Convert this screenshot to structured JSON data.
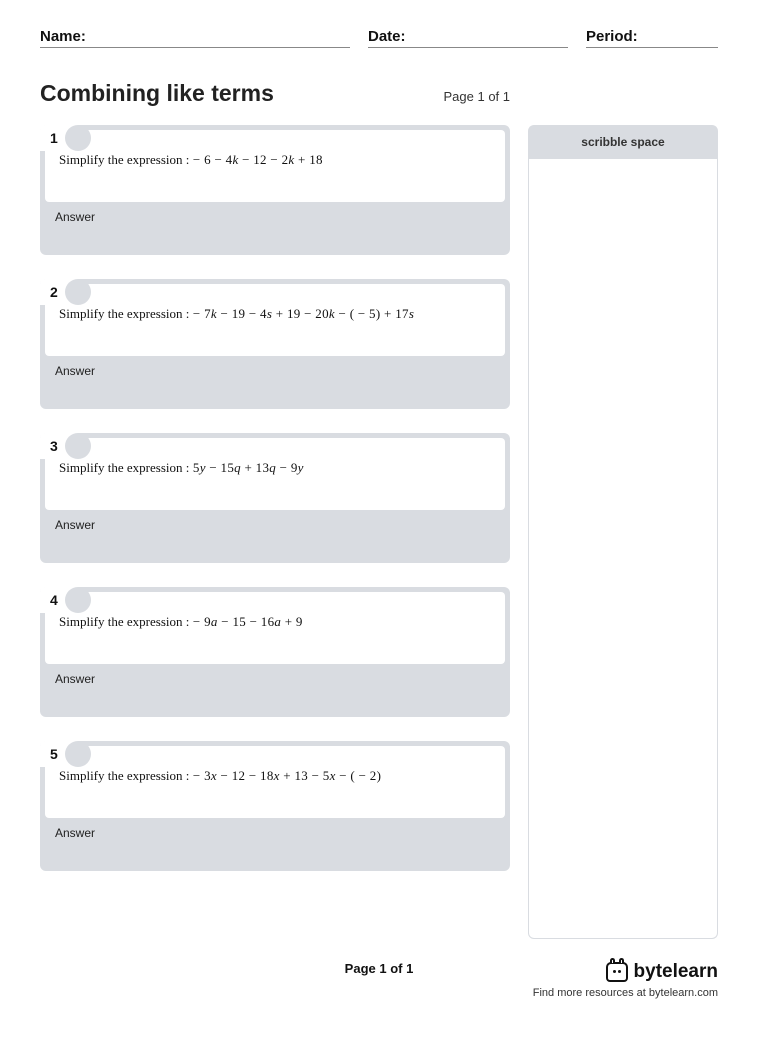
{
  "header": {
    "name_label": "Name:",
    "date_label": "Date:",
    "period_label": "Period:"
  },
  "title": "Combining like terms",
  "page_indicator": "Page 1 of 1",
  "scribble_label": "scribble space",
  "answer_label": "Answer",
  "questions": [
    {
      "number": "1",
      "prompt": "Simplify the expression :",
      "expression_html": " − 6 − 4<span class='v'>k</span> − 12 − 2<span class='v'>k</span> + 18"
    },
    {
      "number": "2",
      "prompt": "Simplify the expression :",
      "expression_html": " − 7<span class='v'>k</span> − 19 − 4<span class='v'>s</span> + 19 − 20<span class='v'>k</span> − ( − 5) + 17<span class='v'>s</span>"
    },
    {
      "number": "3",
      "prompt": "Simplify the expression :",
      "expression_html": " 5<span class='v'>y</span> − 15<span class='v'>q</span> + 13<span class='v'>q</span> − 9<span class='v'>y</span>"
    },
    {
      "number": "4",
      "prompt": "Simplify the expression :",
      "expression_html": " − 9<span class='v'>a</span> − 15 − 16<span class='v'>a</span> + 9"
    },
    {
      "number": "5",
      "prompt": "Simplify the expression :",
      "expression_html": " − 3<span class='v'>x</span> − 12 − 18<span class='v'>x</span> + 13 − 5<span class='v'>x</span> − ( − 2)"
    }
  ],
  "footer": {
    "page_label": "Page 1 of 1",
    "brand": "bytelearn",
    "tagline": "Find more resources at bytelearn.com"
  }
}
